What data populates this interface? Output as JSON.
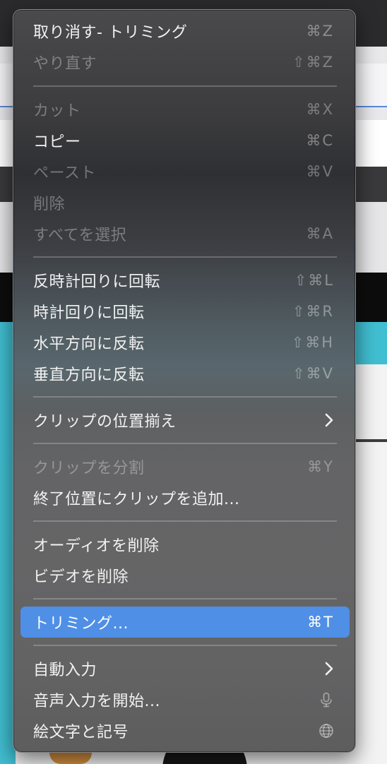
{
  "menu": {
    "items": [
      {
        "label": "取り消す- トリミング",
        "shortcut": "⌘Z",
        "disabled": false
      },
      {
        "label": "やり直す",
        "shortcut": "⇧⌘Z",
        "disabled": true
      },
      {
        "label": "カット",
        "shortcut": "⌘X",
        "disabled": true
      },
      {
        "label": "コピー",
        "shortcut": "⌘C",
        "disabled": false
      },
      {
        "label": "ペースト",
        "shortcut": "⌘V",
        "disabled": true
      },
      {
        "label": "削除",
        "shortcut": "",
        "disabled": true
      },
      {
        "label": "すべてを選択",
        "shortcut": "⌘A",
        "disabled": true
      },
      {
        "label": "反時計回りに回転",
        "shortcut": "⇧⌘L",
        "disabled": false
      },
      {
        "label": "時計回りに回転",
        "shortcut": "⇧⌘R",
        "disabled": false
      },
      {
        "label": "水平方向に反転",
        "shortcut": "⇧⌘H",
        "disabled": false
      },
      {
        "label": "垂直方向に反転",
        "shortcut": "⇧⌘V",
        "disabled": false
      },
      {
        "label": "クリップの位置揃え",
        "icon": "chevron-right-icon",
        "disabled": false
      },
      {
        "label": "クリップを分割",
        "shortcut": "⌘Y",
        "disabled": true
      },
      {
        "label": "終了位置にクリップを追加...",
        "shortcut": "",
        "disabled": false
      },
      {
        "label": "オーディオを削除",
        "shortcut": "",
        "disabled": false
      },
      {
        "label": "ビデオを削除",
        "shortcut": "",
        "disabled": false
      },
      {
        "label": "トリミング...",
        "shortcut": "⌘T",
        "disabled": false,
        "highlighted": true
      },
      {
        "label": "自動入力",
        "icon": "chevron-right-icon",
        "disabled": false
      },
      {
        "label": "音声入力を開始...",
        "icon": "microphone-icon",
        "disabled": false
      },
      {
        "label": "絵文字と記号",
        "icon": "globe-icon",
        "disabled": false
      }
    ]
  },
  "colors": {
    "highlight": "#4f8fe6",
    "menu_text": "#f2f2f2"
  }
}
